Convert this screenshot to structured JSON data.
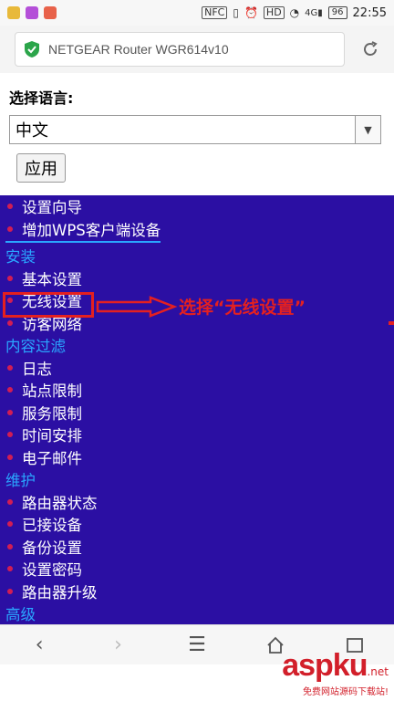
{
  "statusbar": {
    "time": "22:55",
    "battery": "96",
    "nfc": "NFC",
    "hd": "HD",
    "net": "4G"
  },
  "browser": {
    "url": "NETGEAR Router WGR614v10"
  },
  "language": {
    "label": "选择语言:",
    "selected": "中文",
    "apply_label": "应用"
  },
  "menu": {
    "items_top": [
      "设置向导",
      "增加WPS客户端设备"
    ],
    "section_install": "安装",
    "items_install": [
      "基本设置",
      "无线设置",
      "访客网络"
    ],
    "section_filter": "内容过滤",
    "items_filter": [
      "日志",
      "站点限制",
      "服务限制",
      "时间安排",
      "电子邮件"
    ],
    "section_maint": "维护",
    "items_maint": [
      "路由器状态",
      "已接设备",
      "备份设置",
      "设置密码",
      "路由器升级"
    ],
    "section_advanced": "高级"
  },
  "annotation": {
    "text": "选择“无线设置”",
    "color": "#e42020"
  },
  "watermark": {
    "main": "aspku",
    "domain": ".net",
    "sub": "免费网站源码下载站!"
  },
  "colors": {
    "menu_bg": "#2b0fa3",
    "section": "#2aa6ff",
    "bullet": "#d11d54"
  }
}
